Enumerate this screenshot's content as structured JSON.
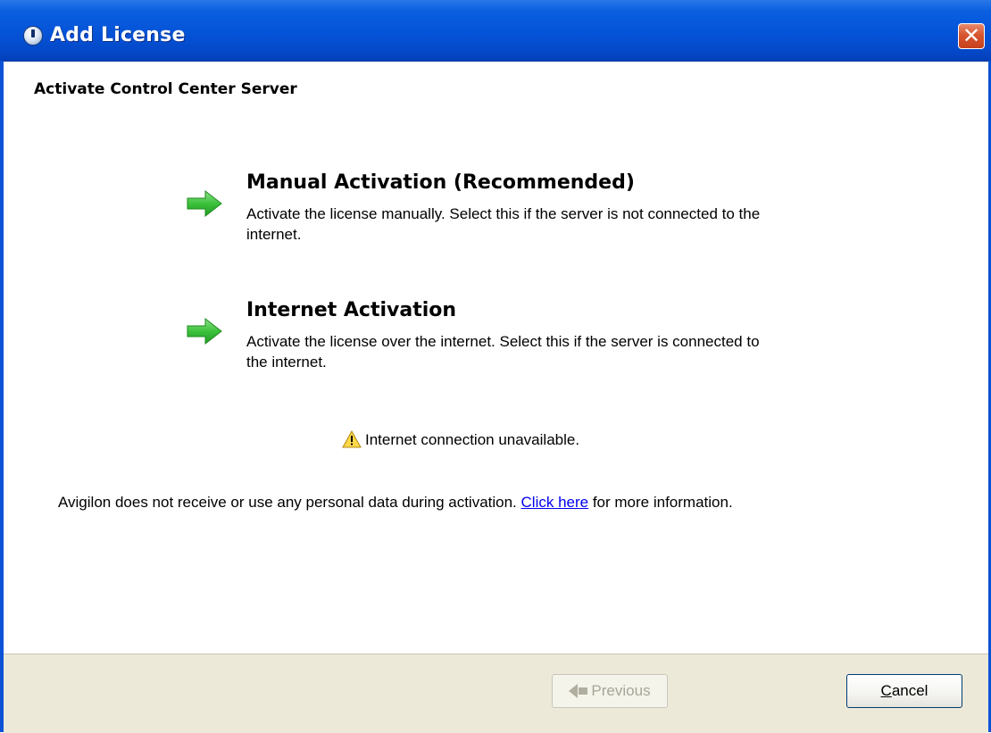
{
  "window": {
    "title": "Add License",
    "close_symbol": "✕"
  },
  "page": {
    "heading": "Activate Control Center Server"
  },
  "options": [
    {
      "title": "Manual Activation (Recommended)",
      "description": "Activate the license manually.  Select this if the server is not connected to the internet.",
      "icon": "green-arrow-icon"
    },
    {
      "title": "Internet Activation",
      "description": "Activate the license over the internet.  Select this if the server is connected to the internet.",
      "icon": "green-arrow-icon"
    }
  ],
  "warning": {
    "text": "Internet connection unavailable.",
    "icon": "warning-icon"
  },
  "privacy": {
    "before_link": "Avigilon does not receive or use any personal data during activation. ",
    "link_text": "Click here",
    "after_link": " for more information."
  },
  "footer": {
    "previous_label": "Previous",
    "cancel_label_first": "C",
    "cancel_label_rest": "ancel"
  },
  "colors": {
    "titlebar": "#0553d8",
    "arrow": "#3bbf3b",
    "link": "#0000ee",
    "footer_bg": "#ece9d8"
  }
}
